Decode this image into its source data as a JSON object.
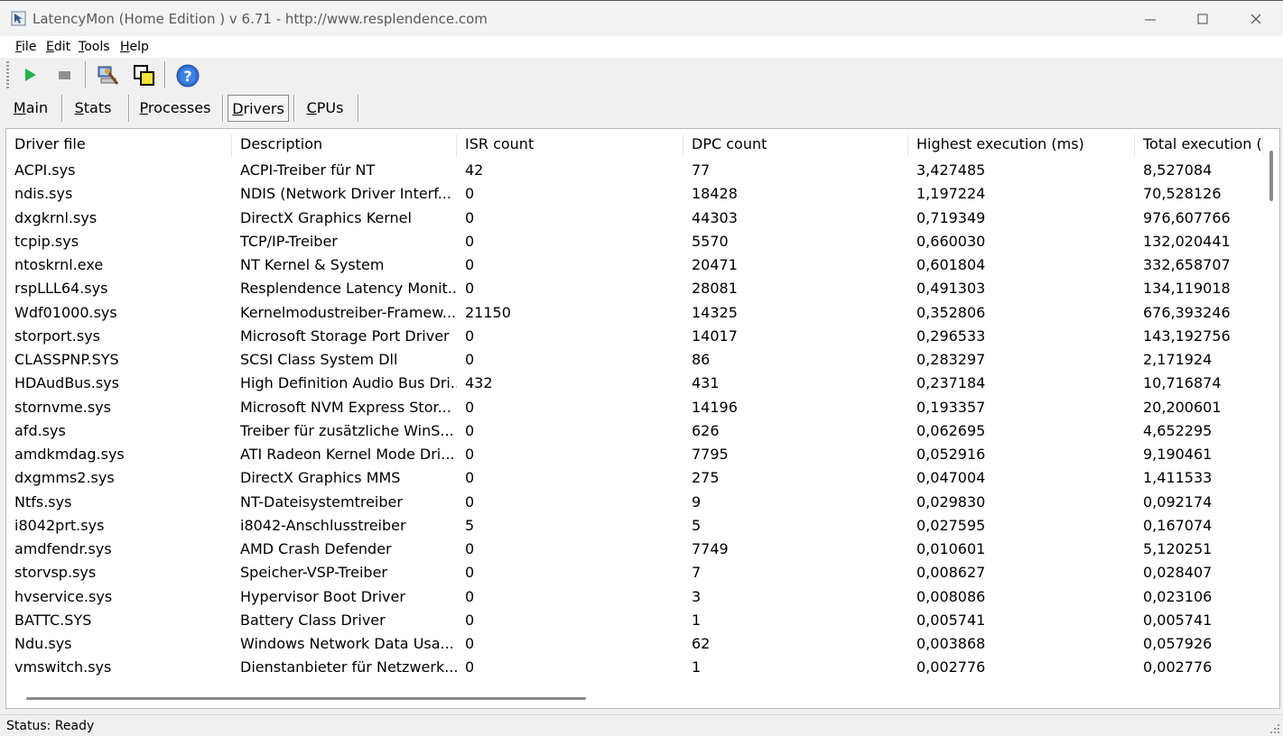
{
  "window": {
    "title": "LatencyMon  (Home Edition )  v 6.71 - http://www.resplendence.com"
  },
  "menu": [
    {
      "first": "F",
      "rest": "ile"
    },
    {
      "first": "E",
      "rest": "dit"
    },
    {
      "first": "T",
      "rest": "ools"
    },
    {
      "first": "H",
      "rest": "elp"
    }
  ],
  "toolbar": {
    "icons": [
      "play-icon",
      "stop-icon",
      "computer-scan-icon",
      "windows-icon",
      "help-icon"
    ]
  },
  "tabs": [
    {
      "first": "M",
      "rest": "ain"
    },
    {
      "first": "S",
      "rest": "tats"
    },
    {
      "first": "P",
      "rest": "rocesses"
    },
    {
      "first": "D",
      "rest": "rivers"
    },
    {
      "first": "C",
      "rest": "PUs"
    }
  ],
  "table": {
    "columns": [
      "Driver file",
      "Description",
      "ISR count",
      "DPC count",
      "Highest execution (ms)",
      "Total execution ("
    ],
    "rows": [
      [
        "ACPI.sys",
        "ACPI-Treiber für NT",
        "42",
        "77",
        "3,427485",
        "8,527084"
      ],
      [
        "ndis.sys",
        "NDIS (Network Driver Interf...",
        "0",
        "18428",
        "1,197224",
        "70,528126"
      ],
      [
        "dxgkrnl.sys",
        "DirectX Graphics Kernel",
        "0",
        "44303",
        "0,719349",
        "976,607766"
      ],
      [
        "tcpip.sys",
        "TCP/IP-Treiber",
        "0",
        "5570",
        "0,660030",
        "132,020441"
      ],
      [
        "ntoskrnl.exe",
        "NT Kernel & System",
        "0",
        "20471",
        "0,601804",
        "332,658707"
      ],
      [
        "rspLLL64.sys",
        "Resplendence Latency Monit...",
        "0",
        "28081",
        "0,491303",
        "134,119018"
      ],
      [
        "Wdf01000.sys",
        "Kernelmodustreiber-Framew...",
        "21150",
        "14325",
        "0,352806",
        "676,393246"
      ],
      [
        "storport.sys",
        "Microsoft Storage Port Driver",
        "0",
        "14017",
        "0,296533",
        "143,192756"
      ],
      [
        "CLASSPNP.SYS",
        "SCSI Class System Dll",
        "0",
        "86",
        "0,283297",
        "2,171924"
      ],
      [
        "HDAudBus.sys",
        "High Definition Audio Bus Dri...",
        "432",
        "431",
        "0,237184",
        "10,716874"
      ],
      [
        "stornvme.sys",
        "Microsoft NVM Express Stor...",
        "0",
        "14196",
        "0,193357",
        "20,200601"
      ],
      [
        "afd.sys",
        "Treiber für zusätzliche WinS...",
        "0",
        "626",
        "0,062695",
        "4,652295"
      ],
      [
        "amdkmdag.sys",
        "ATI Radeon Kernel Mode Dri...",
        "0",
        "7795",
        "0,052916",
        "9,190461"
      ],
      [
        "dxgmms2.sys",
        "DirectX Graphics MMS",
        "0",
        "275",
        "0,047004",
        "1,411533"
      ],
      [
        "Ntfs.sys",
        "NT-Dateisystemtreiber",
        "0",
        "9",
        "0,029830",
        "0,092174"
      ],
      [
        "i8042prt.sys",
        "i8042-Anschlusstreiber",
        "5",
        "5",
        "0,027595",
        "0,167074"
      ],
      [
        "amdfendr.sys",
        "AMD Crash Defender",
        "0",
        "7749",
        "0,010601",
        "5,120251"
      ],
      [
        "storvsp.sys",
        "Speicher-VSP-Treiber",
        "0",
        "7",
        "0,008627",
        "0,028407"
      ],
      [
        "hvservice.sys",
        "Hypervisor Boot Driver",
        "0",
        "3",
        "0,008086",
        "0,023106"
      ],
      [
        "BATTC.SYS",
        "Battery Class Driver",
        "0",
        "1",
        "0,005741",
        "0,005741"
      ],
      [
        "Ndu.sys",
        "Windows Network Data Usa...",
        "0",
        "62",
        "0,003868",
        "0,057926"
      ],
      [
        "vmswitch.sys",
        "Dienstanbieter für Netzwerk...",
        "0",
        "1",
        "0,002776",
        "0,002776"
      ]
    ]
  },
  "status": {
    "text": "Status: Ready"
  }
}
